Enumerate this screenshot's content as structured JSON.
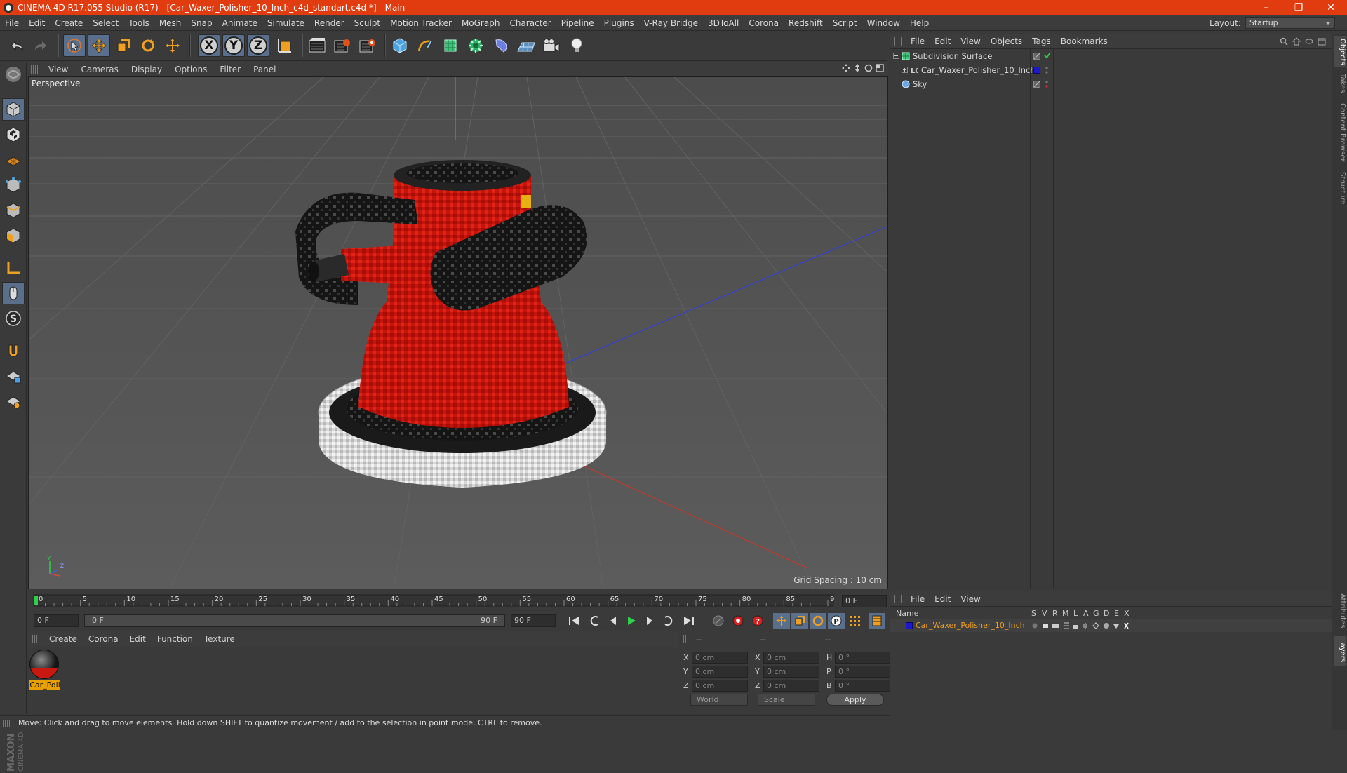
{
  "window": {
    "title": "CINEMA 4D R17.055 Studio (R17) - [Car_Waxer_Polisher_10_Inch_c4d_standart.c4d *] - Main",
    "controls": [
      "–",
      "❐",
      "✕"
    ]
  },
  "menubar": {
    "items": [
      "File",
      "Edit",
      "Create",
      "Select",
      "Tools",
      "Mesh",
      "Snap",
      "Animate",
      "Simulate",
      "Render",
      "Sculpt",
      "Motion Tracker",
      "MoGraph",
      "Character",
      "Pipeline",
      "Plugins",
      "V-Ray Bridge",
      "3DToAll",
      "Corona",
      "Redshift",
      "Script",
      "Window",
      "Help"
    ],
    "layout_label": "Layout:",
    "layout_value": "Startup"
  },
  "viewport": {
    "menu": [
      "View",
      "Cameras",
      "Display",
      "Options",
      "Filter",
      "Panel"
    ],
    "label": "Perspective",
    "grid_spacing": "Grid Spacing : 10 cm",
    "axes_gizmo": {
      "y": "Y",
      "z": "Z"
    }
  },
  "timeline": {
    "ticks": [
      "0",
      "5",
      "10",
      "15",
      "20",
      "25",
      "30",
      "35",
      "40",
      "45",
      "50",
      "55",
      "60",
      "65",
      "70",
      "75",
      "80",
      "85",
      "90"
    ],
    "current_frame": "0 F",
    "start_field": "0 F",
    "range_start": "0 F",
    "range_end": "90 F",
    "end_field": "90 F"
  },
  "material_manager": {
    "menu": [
      "Create",
      "Corona",
      "Edit",
      "Function",
      "Texture"
    ],
    "materials": [
      {
        "name": "Car_Poli"
      }
    ]
  },
  "coordinates": {
    "headers": [
      "--",
      "--",
      "--"
    ],
    "rows": [
      {
        "a": "X",
        "av": "0 cm",
        "b": "X",
        "bv": "0 cm",
        "c": "H",
        "cv": "0 °"
      },
      {
        "a": "Y",
        "av": "0 cm",
        "b": "Y",
        "bv": "0 cm",
        "c": "P",
        "cv": "0 °"
      },
      {
        "a": "Z",
        "av": "0 cm",
        "b": "Z",
        "bv": "0 cm",
        "c": "B",
        "cv": "0 °"
      }
    ],
    "mode1": "World",
    "mode2": "Scale",
    "apply": "Apply"
  },
  "status": {
    "text": "Move: Click and drag to move elements. Hold down SHIFT to quantize movement / add to the selection in point mode, CTRL to remove."
  },
  "object_manager": {
    "menu": [
      "File",
      "Edit",
      "View",
      "Objects",
      "Tags",
      "Bookmarks"
    ],
    "objects": [
      {
        "name": "Subdivision Surface"
      },
      {
        "name": "Car_Waxer_Polisher_10_Inch"
      },
      {
        "name": "Sky"
      }
    ]
  },
  "right_tabs": [
    "Objects",
    "Takes",
    "Content Browser",
    "Structure",
    "Attributes",
    "Layers"
  ],
  "layer_manager": {
    "menu": [
      "File",
      "Edit",
      "View"
    ],
    "columns": [
      "Name",
      "S",
      "V",
      "R",
      "M",
      "L",
      "A",
      "G",
      "D",
      "E",
      "X"
    ],
    "layers": [
      {
        "name": "Car_Waxer_Polisher_10_Inch",
        "color": "#1a1acc"
      }
    ]
  },
  "brand": "MAXON CINEMA 4D",
  "colors": {
    "title_bar": "#e03c10",
    "active_tool": "#5a6f8c",
    "selection": "#e8a000"
  }
}
